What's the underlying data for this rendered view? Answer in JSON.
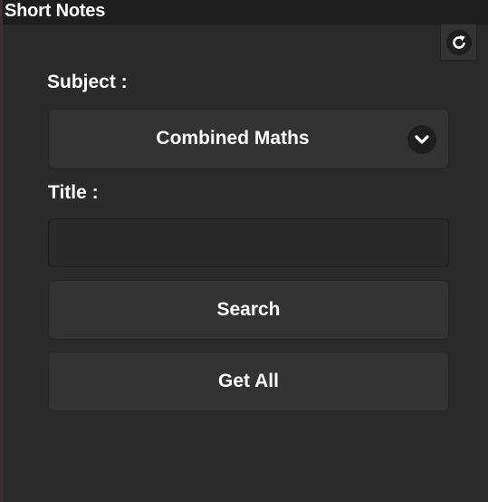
{
  "window": {
    "title": "Short Notes"
  },
  "toolbar": {
    "refresh_icon": "refresh-icon"
  },
  "form": {
    "subject_label": "Subject :",
    "subject_selected": "Combined Maths",
    "subject_dropdown_icon": "chevron-down-icon",
    "title_label": "Title :",
    "title_value": "",
    "title_placeholder": ""
  },
  "actions": {
    "search_label": "Search",
    "get_all_label": "Get All"
  },
  "colors": {
    "background": "#2b2b2b",
    "control": "#333333",
    "input": "#292929",
    "titlebar": "#1e1e1e",
    "text": "#ffffff"
  }
}
